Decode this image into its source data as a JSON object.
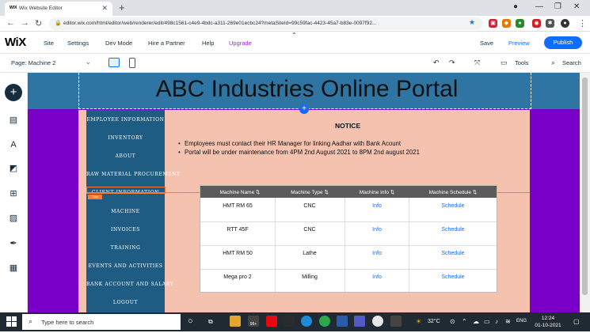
{
  "browser": {
    "tab_title": "Wix Website Editor",
    "tab_favicon": "WIX",
    "new_tab": "+",
    "url": "editor.wix.com/html/editor/web/renderer/edit/498c1561-c4e9-4bdc-a311-269e01ecbc24?metaSiteId=99c59fac-4423-45a7-b83e-0097f92..."
  },
  "wix": {
    "logo": "WiX",
    "menu": [
      "Site",
      "Settings",
      "Dev Mode",
      "Hire a Partner",
      "Help",
      "Upgrade"
    ],
    "save": "Save",
    "preview": "Preview",
    "publish": "Publish",
    "page_selector": "Page: Machine 2",
    "tools": "Tools",
    "search": "Search"
  },
  "site": {
    "title": "ABC Industries Online Portal",
    "nav": [
      "EMPLOYEE INFORMATION",
      "INVENTORY",
      "ABOUT",
      "RAW MATERIAL PROCUREMENT",
      "CLIENT INFORMATION",
      "MACHINE",
      "INVOICES",
      "TRAINING",
      "EVENTS AND ACTIVITIES",
      "BANK ACCOUNT AND SALARY",
      "LOGOUT"
    ],
    "selection_tag": "Text",
    "notice_title": "NOTICE",
    "notices": [
      "Employees must contact their HR Manager for linking Aadhar with Bank Acount",
      "Portal will be under maintenance from 4PM 2nd August 2021 to 8PM 2nd august 2021"
    ],
    "table": {
      "headers": [
        "Machine Name",
        "Machine Type",
        "Machine Info",
        "Machine Schedule"
      ],
      "sort_glyph": "⇅",
      "rows": [
        {
          "name": "HMT RM 65",
          "type": "CNC",
          "info": "Info",
          "schedule": "Schedule"
        },
        {
          "name": "RTT 45F",
          "type": "CNC",
          "info": "Info",
          "schedule": "Schedule"
        },
        {
          "name": "HMT RM 50",
          "type": "Lathe",
          "info": "Info",
          "schedule": "Schedule"
        },
        {
          "name": "Mega pro 2",
          "type": "Milling",
          "info": "Info",
          "schedule": "Schedule"
        }
      ]
    }
  },
  "taskbar": {
    "search_placeholder": "Type here to search",
    "badge": "99+",
    "weather": "32°C",
    "language": "ENG",
    "time": "12:24",
    "date": "01-10-2021"
  },
  "colors": {
    "header_bg": "#2f75a3",
    "side_bg": "#7a00c9",
    "content_bg": "#f6c2b0",
    "nav_bg": "#1f5c84",
    "accent": "#116dff"
  }
}
